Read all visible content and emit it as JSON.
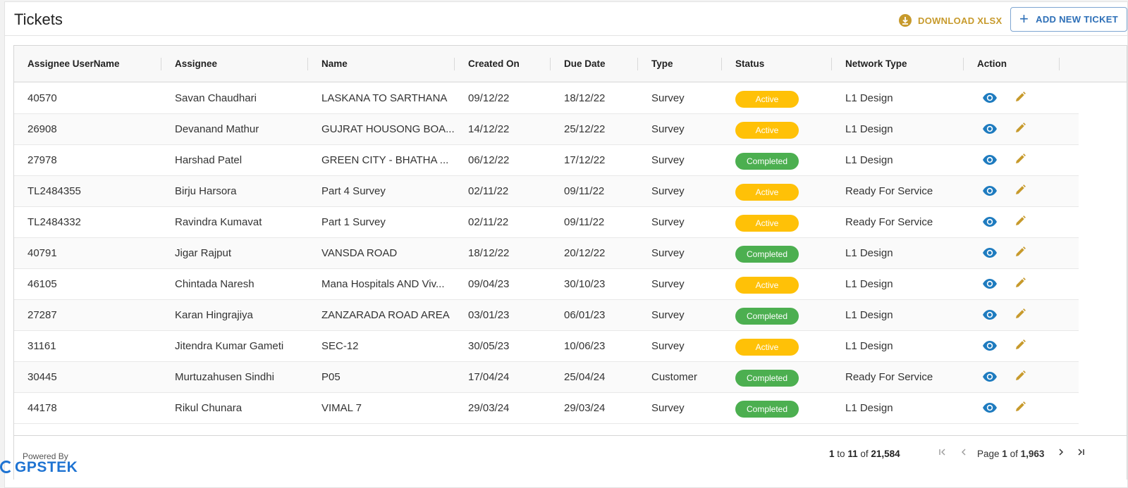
{
  "header": {
    "title": "Tickets",
    "download_label": "DOWNLOAD XLSX",
    "add_label": "ADD NEW TICKET"
  },
  "columns": [
    "Assignee UserName",
    "Assignee",
    "Name",
    "Created On",
    "Due Date",
    "Type",
    "Status",
    "Network Type",
    "Action"
  ],
  "rows": [
    {
      "username": "40570",
      "assignee": "Savan Chaudhari",
      "name": "LASKANA TO SARTHANA",
      "created": "09/12/22",
      "due": "18/12/22",
      "type": "Survey",
      "status": "Active",
      "network": "L1 Design"
    },
    {
      "username": "26908",
      "assignee": "Devanand Mathur",
      "name": "GUJRAT HOUSONG BOA...",
      "created": "14/12/22",
      "due": "25/12/22",
      "type": "Survey",
      "status": "Active",
      "network": "L1 Design"
    },
    {
      "username": "27978",
      "assignee": "Harshad Patel",
      "name": "GREEN CITY - BHATHA ...",
      "created": "06/12/22",
      "due": "17/12/22",
      "type": "Survey",
      "status": "Completed",
      "network": "L1 Design"
    },
    {
      "username": "TL2484355",
      "assignee": "Birju Harsora",
      "name": "Part 4 Survey",
      "created": "02/11/22",
      "due": "09/11/22",
      "type": "Survey",
      "status": "Active",
      "network": "Ready For Service"
    },
    {
      "username": "TL2484332",
      "assignee": "Ravindra Kumavat",
      "name": "Part 1 Survey",
      "created": "02/11/22",
      "due": "09/11/22",
      "type": "Survey",
      "status": "Active",
      "network": "Ready For Service"
    },
    {
      "username": "40791",
      "assignee": "Jigar Rajput",
      "name": "VANSDA ROAD",
      "created": "18/12/22",
      "due": "20/12/22",
      "type": "Survey",
      "status": "Completed",
      "network": "L1 Design"
    },
    {
      "username": "46105",
      "assignee": "Chintada Naresh",
      "name": "Mana Hospitals AND Viv...",
      "created": "09/04/23",
      "due": "30/10/23",
      "type": "Survey",
      "status": "Active",
      "network": "L1 Design"
    },
    {
      "username": "27287",
      "assignee": "Karan Hingrajiya",
      "name": "ZANZARADA ROAD AREA",
      "created": "03/01/23",
      "due": "06/01/23",
      "type": "Survey",
      "status": "Completed",
      "network": "L1 Design"
    },
    {
      "username": "31161",
      "assignee": "Jitendra Kumar Gameti",
      "name": "SEC-12",
      "created": "30/05/23",
      "due": "10/06/23",
      "type": "Survey",
      "status": "Active",
      "network": "L1 Design"
    },
    {
      "username": "30445",
      "assignee": "Murtuzahusen Sindhi",
      "name": "P05",
      "created": "17/04/24",
      "due": "25/04/24",
      "type": "Customer",
      "status": "Completed",
      "network": "Ready For Service"
    },
    {
      "username": "44178",
      "assignee": "Rikul Chunara",
      "name": "VIMAL 7",
      "created": "29/03/24",
      "due": "29/03/24",
      "type": "Survey",
      "status": "Completed",
      "network": "L1 Design"
    }
  ],
  "footer": {
    "powered_by": "Powered By",
    "logo_text": "GPSTEK",
    "range_from": "1",
    "range_to_word": "to",
    "range_to": "11",
    "of_word": "of",
    "total": "21,584",
    "page_word": "Page",
    "page_current": "1",
    "page_total": "1,963"
  },
  "colors": {
    "active": "#ffc107",
    "completed": "#4caf50",
    "download": "#c79a2c",
    "add": "#2d6fb7",
    "view_icon": "#1e7bbf",
    "edit_icon": "#c79a2c"
  },
  "icons": {
    "download": "download-icon",
    "add": "plus-icon",
    "view": "eye-icon",
    "edit": "pencil-icon",
    "first": "first-page-icon",
    "prev": "chevron-left-icon",
    "next": "chevron-right-icon",
    "last": "last-page-icon"
  }
}
